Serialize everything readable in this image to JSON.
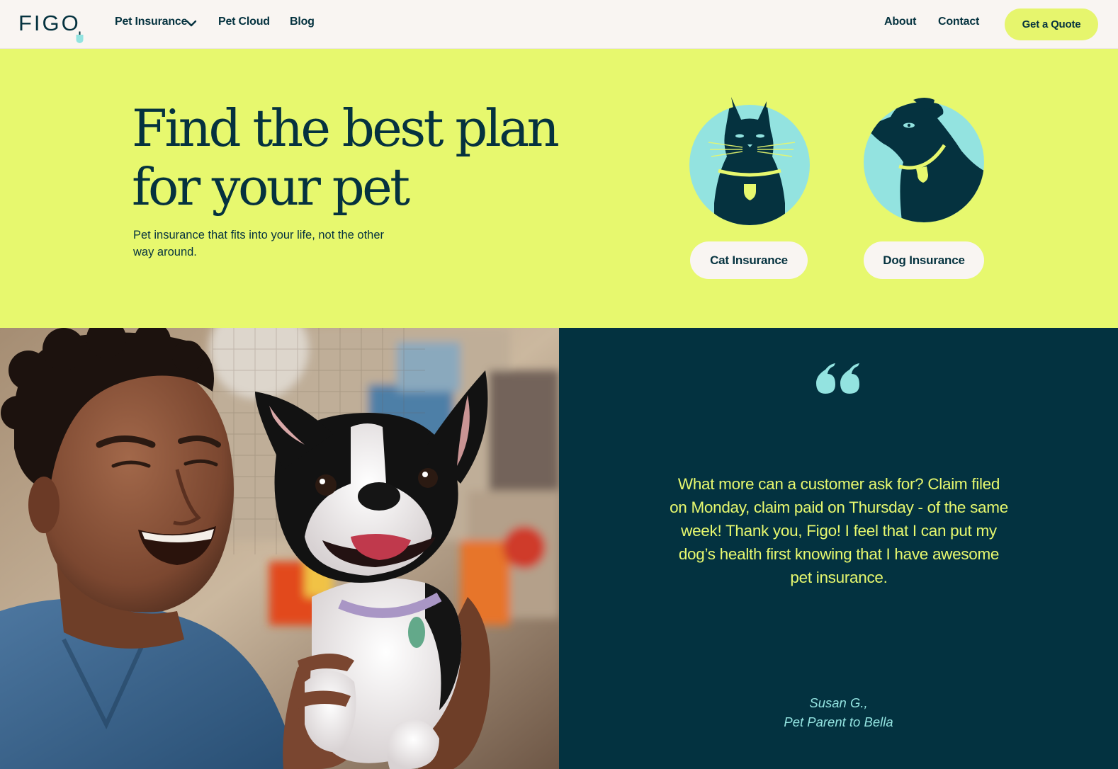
{
  "nav": {
    "logo_text": "FIGO",
    "links": {
      "pet_insurance": "Pet Insurance",
      "pet_cloud": "Pet Cloud",
      "blog": "Blog",
      "about": "About",
      "contact": "Contact"
    },
    "cta": "Get a Quote",
    "icons": {
      "dropdown": "chevron-down-icon",
      "logo_tag": "pet-tag-icon"
    }
  },
  "hero": {
    "title": "Find the best plan for your pet",
    "subtitle": "Pet insurance that fits into your life, not the other way around.",
    "cat_button": "Cat Insurance",
    "dog_button": "Dog Insurance",
    "icons": {
      "cat": "cat-illustration-icon",
      "dog": "dog-illustration-icon"
    }
  },
  "testimonial": {
    "quote": "What more can a customer ask for? Claim filed on Monday, claim paid on Thursday - of the same week! Thank you, Figo! I feel that I can put my dog’s health first knowing that I have awesome pet insurance.",
    "author": "Susan G.,",
    "author_role": "Pet Parent to Bella",
    "icon": "quote-mark-icon"
  },
  "colors": {
    "navy": "#05323f",
    "lime": "#e7f86e",
    "aqua": "#93e3e0",
    "cream": "#f9f5f2",
    "dark_panel": "#033240"
  }
}
